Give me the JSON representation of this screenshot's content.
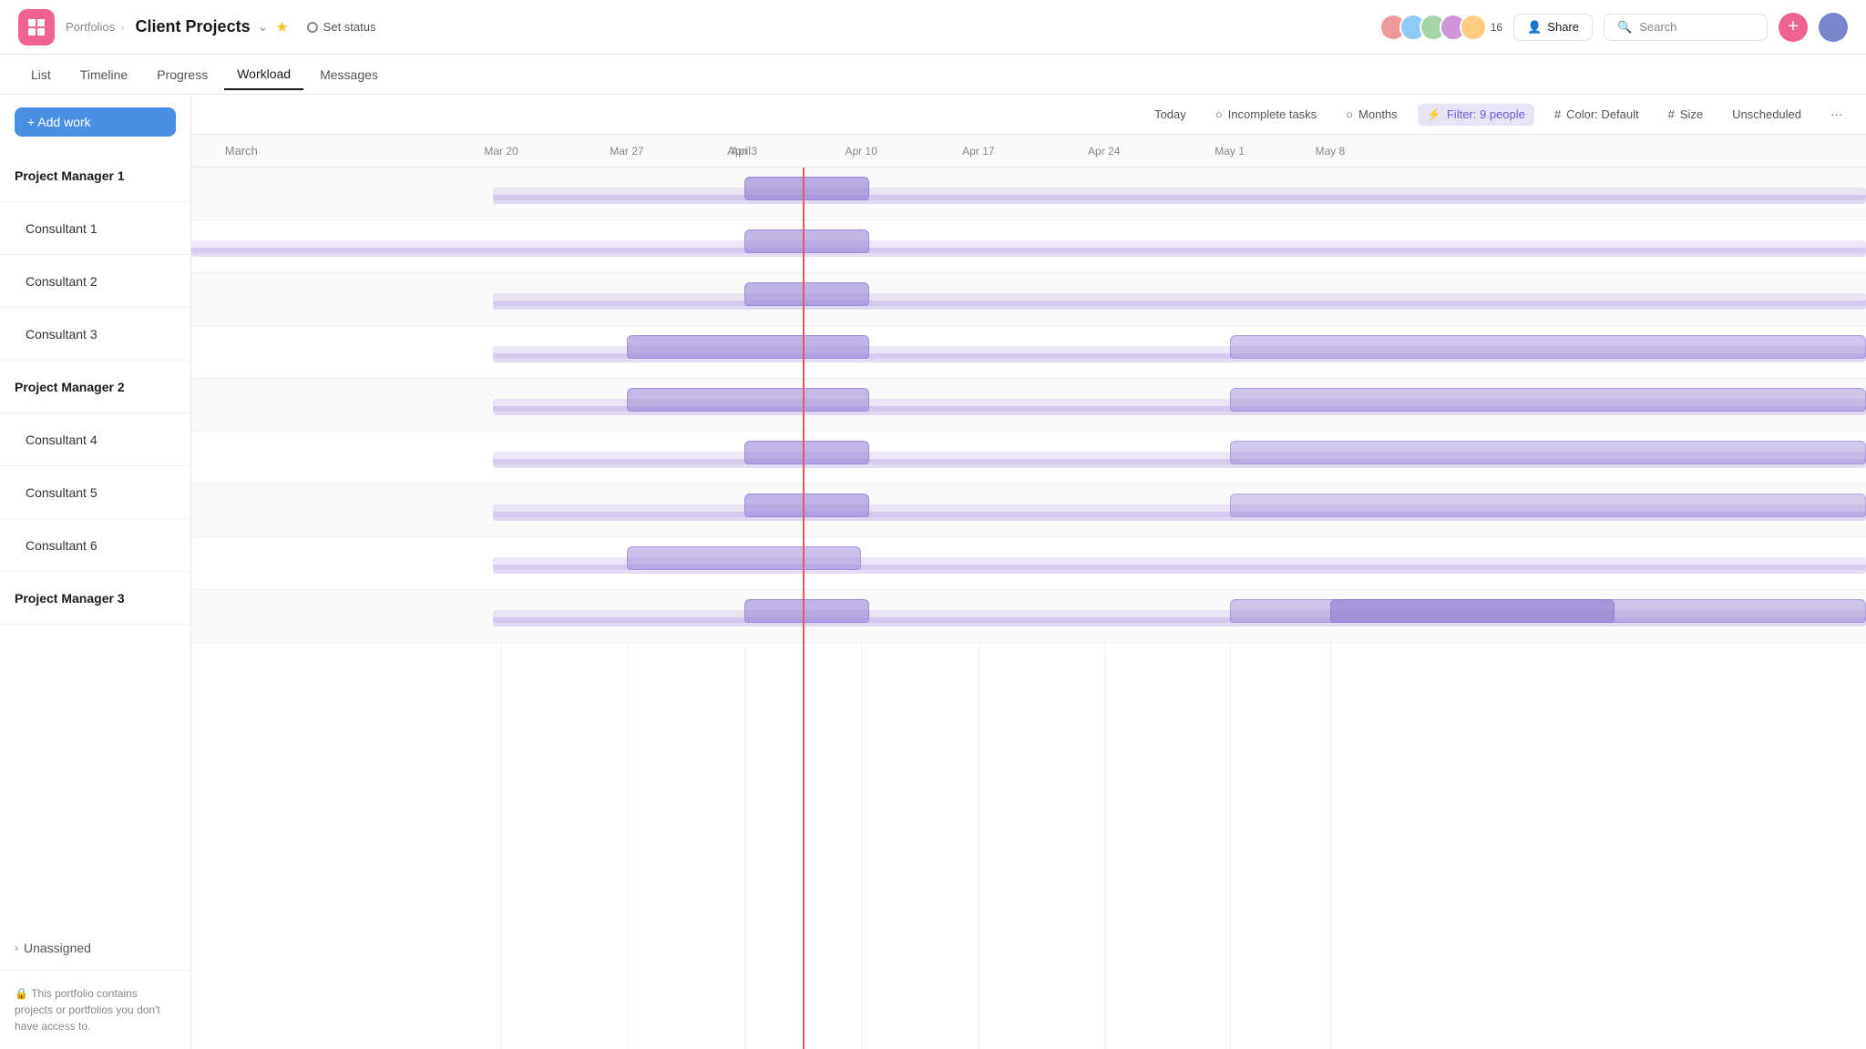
{
  "app": {
    "icon": "▣",
    "breadcrumb": "Portfolios",
    "title": "Client Projects",
    "status_label": "Set status",
    "add_label": "+ Add work"
  },
  "header_right": {
    "avatar_count": "16",
    "share_label": "Share",
    "search_placeholder": "Search"
  },
  "subnav": {
    "items": [
      "List",
      "Timeline",
      "Progress",
      "Workload",
      "Messages"
    ],
    "active": "Workload"
  },
  "toolbar": {
    "today": "Today",
    "incomplete": "Incomplete tasks",
    "months": "Months",
    "filter": "Filter: 9 people",
    "color": "Color: Default",
    "size": "Size",
    "unscheduled": "Unscheduled",
    "more": "···"
  },
  "dates": {
    "months": [
      {
        "label": "March",
        "left_pct": 2
      },
      {
        "label": "April",
        "left_pct": 32
      }
    ],
    "ticks": [
      {
        "label": "Mar 20",
        "left_pct": 18.5
      },
      {
        "label": "Mar 27",
        "left_pct": 26
      },
      {
        "label": "Apr 3",
        "left_pct": 33
      },
      {
        "label": "Apr 10",
        "left_pct": 40
      },
      {
        "label": "Apr 17",
        "left_pct": 47
      },
      {
        "label": "Apr 24",
        "left_pct": 54.5
      },
      {
        "label": "May 1",
        "left_pct": 62
      },
      {
        "label": "May 8",
        "left_pct": 68
      }
    ]
  },
  "people": [
    {
      "name": "Project Manager 1",
      "type": "manager"
    },
    {
      "name": "Consultant 1",
      "type": "consultant"
    },
    {
      "name": "Consultant 2",
      "type": "consultant"
    },
    {
      "name": "Consultant 3",
      "type": "consultant"
    },
    {
      "name": "Project Manager 2",
      "type": "manager"
    },
    {
      "name": "Consultant 4",
      "type": "consultant"
    },
    {
      "name": "Consultant 5",
      "type": "consultant"
    },
    {
      "name": "Consultant 6",
      "type": "consultant"
    },
    {
      "name": "Project Manager 3",
      "type": "manager"
    }
  ],
  "unassigned_label": "Unassigned",
  "footer_note": "This portfolio contains projects or portfolios you don't have access to.",
  "chart": {
    "today_pct": 36.5,
    "rows": [
      {
        "bars": [
          {
            "start": 18,
            "end": 100,
            "intensity": 0.3
          },
          {
            "start": 33,
            "end": 40.5,
            "intensity": 0.6
          }
        ]
      },
      {
        "bars": [
          {
            "start": 0,
            "end": 100,
            "intensity": 0.25
          },
          {
            "start": 33,
            "end": 40.5,
            "intensity": 0.55
          }
        ]
      },
      {
        "bars": [
          {
            "start": 18,
            "end": 100,
            "intensity": 0.25
          },
          {
            "start": 33,
            "end": 40.5,
            "intensity": 0.55
          }
        ]
      },
      {
        "bars": [
          {
            "start": 18,
            "end": 100,
            "intensity": 0.3
          },
          {
            "start": 26,
            "end": 40.5,
            "intensity": 0.55
          },
          {
            "start": 62,
            "end": 100,
            "intensity": 0.4
          }
        ]
      },
      {
        "bars": [
          {
            "start": 18,
            "end": 100,
            "intensity": 0.25
          },
          {
            "start": 26,
            "end": 40.5,
            "intensity": 0.5
          },
          {
            "start": 62,
            "end": 100,
            "intensity": 0.4
          }
        ]
      },
      {
        "bars": [
          {
            "start": 18,
            "end": 100,
            "intensity": 0.25
          },
          {
            "start": 33,
            "end": 40.5,
            "intensity": 0.55
          },
          {
            "start": 62,
            "end": 100,
            "intensity": 0.4
          }
        ]
      },
      {
        "bars": [
          {
            "start": 18,
            "end": 100,
            "intensity": 0.25
          },
          {
            "start": 33,
            "end": 40.5,
            "intensity": 0.55
          },
          {
            "start": 62,
            "end": 100,
            "intensity": 0.35
          }
        ]
      },
      {
        "bars": [
          {
            "start": 18,
            "end": 100,
            "intensity": 0.25
          },
          {
            "start": 26,
            "end": 40,
            "intensity": 0.45
          }
        ]
      },
      {
        "bars": [
          {
            "start": 18,
            "end": 100,
            "intensity": 0.25
          },
          {
            "start": 33,
            "end": 40.5,
            "intensity": 0.55
          },
          {
            "start": 62,
            "end": 100,
            "intensity": 0.4
          },
          {
            "start": 68,
            "end": 85,
            "intensity": 0.6
          }
        ]
      }
    ]
  }
}
